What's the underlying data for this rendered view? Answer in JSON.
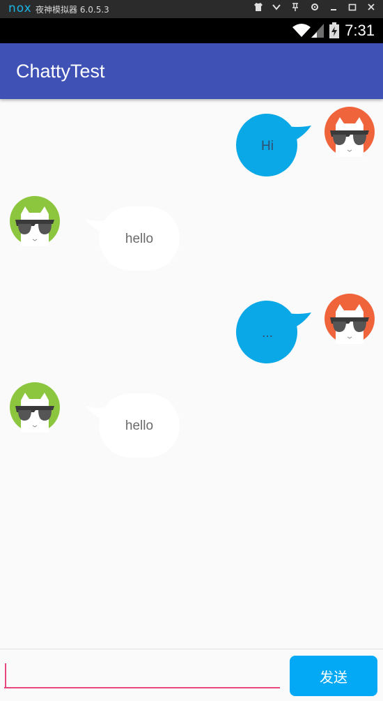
{
  "emulator": {
    "logo": "nox",
    "title": "夜神模拟器 6.0.5.3"
  },
  "status_bar": {
    "time": "7:31"
  },
  "app_bar": {
    "title": "ChattyTest"
  },
  "messages": [
    {
      "side": "right",
      "text": "Hi",
      "bubble_color": "#0aa8e6",
      "avatar_color": "#f0643c"
    },
    {
      "side": "left",
      "text": "hello",
      "bubble_color": "#ffffff",
      "avatar_color": "#8cc63f"
    },
    {
      "side": "right",
      "text": "...",
      "bubble_color": "#0aa8e6",
      "avatar_color": "#f0643c"
    },
    {
      "side": "left",
      "text": "hello",
      "bubble_color": "#ffffff",
      "avatar_color": "#8cc63f"
    }
  ],
  "input": {
    "value": "",
    "placeholder": ""
  },
  "send_button": {
    "label": "发送"
  },
  "colors": {
    "primary": "#3f51b5",
    "accent": "#e8467e",
    "send": "#03a9f4"
  }
}
